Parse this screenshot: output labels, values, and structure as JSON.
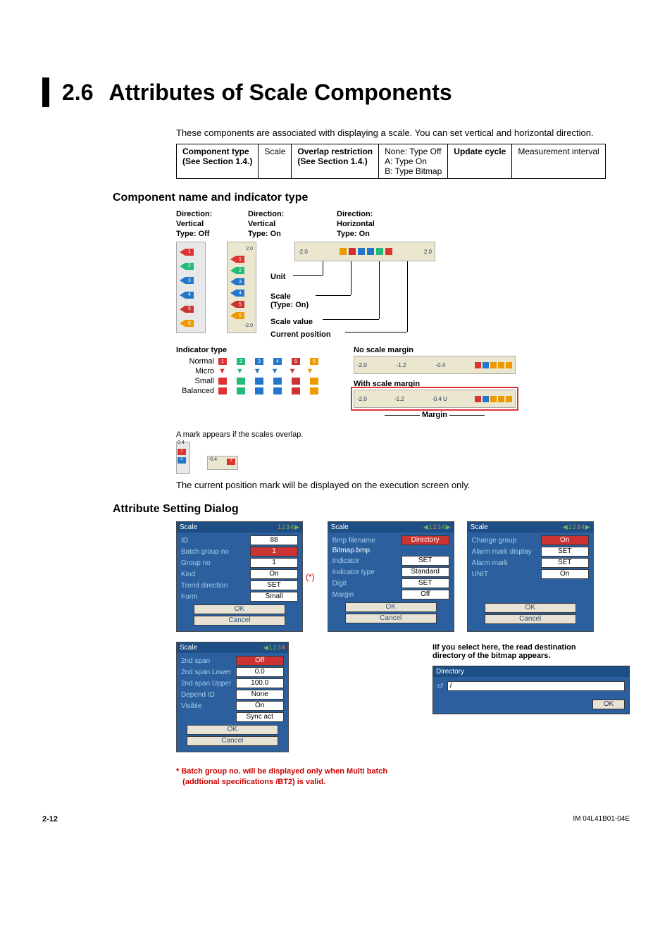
{
  "section_number": "2.6",
  "section_title": "Attributes of Scale Components",
  "intro": "These components are associated with displaying a scale. You can set vertical and horizontal direction.",
  "comp_table": {
    "c1h": "Component type",
    "c1s": "(See Section 1.4.)",
    "c1v": "Scale",
    "c2h": "Overlap restriction",
    "c2s": "(See Section 1.4.)",
    "c2v1": "None: Type Off",
    "c2v2": "A: Type On",
    "c2v3": "B: Type Bitmap",
    "c3h": "Update cycle",
    "c3v": "Measurement interval"
  },
  "h2a": "Component name and indicator type",
  "dirs": {
    "d1a": "Direction:",
    "d1b": "Vertical",
    "d1c": "Type: Off",
    "d2a": "Direction:",
    "d2b": "Vertical",
    "d2c": "Type: On",
    "d3a": "Direction:",
    "d3b": "Horizontal",
    "d3c": "Type: On"
  },
  "callouts": {
    "unit": "Unit",
    "scale1": "Scale",
    "scale2": "(Type: On)",
    "scalevalue": "Scale value",
    "curpos": "Current position"
  },
  "hscale": {
    "left": "-2.0",
    "right": "2.0"
  },
  "indicator": {
    "title": "Indicator type",
    "rows": [
      "Normal",
      "Micro",
      "Small",
      "Balanced"
    ],
    "colors": [
      "#d33",
      "#2b7",
      "#27c",
      "#aa4",
      "#c55",
      "#e90"
    ]
  },
  "margins": {
    "no": "No scale margin",
    "with": "With scale margin",
    "margin": "Margin",
    "a": "-2.0",
    "b": "-1.2",
    "c": "-0.4"
  },
  "overlap_note": "A mark appears if the scales overlap.",
  "ov_v_val": "0.4",
  "ov_h_val": "-0.4",
  "exec_note": "The current position mark will be displayed on the execution screen only.",
  "h2b": "Attribute Setting Dialog",
  "dlg1": {
    "title": "Scale",
    "tabs": "1 2 3 4 ▶",
    "fields": [
      [
        "ID",
        "88"
      ],
      [
        "Batch group no",
        "1"
      ],
      [
        "Group no",
        "1"
      ],
      [
        "Kind",
        "On"
      ],
      [
        "Trend direction",
        "SET"
      ],
      [
        "Form",
        "Small"
      ]
    ],
    "ok": "OK",
    "cancel": "Cancel"
  },
  "dlg2": {
    "title": "Scale",
    "tabs": "◀ 1 2 3 4 ▶",
    "fields": [
      [
        "Bmp filename",
        "Directory"
      ],
      [
        "Bitmap.bmp",
        ""
      ],
      [
        "Indicator",
        "SET"
      ],
      [
        "Indicator type",
        "Standard"
      ],
      [
        "Digit",
        "SET"
      ],
      [
        "Margin",
        "Off"
      ]
    ],
    "ok": "OK",
    "cancel": "Cancel"
  },
  "dlg3": {
    "title": "Scale",
    "tabs": "◀ 1 2 3 4 ▶",
    "fields": [
      [
        "Change group",
        "On"
      ],
      [
        "Alarm mark display",
        "SET"
      ],
      [
        "Alarm mark",
        "SET"
      ],
      [
        "UNIT",
        "On"
      ]
    ],
    "ok": "OK",
    "cancel": "Cancel"
  },
  "dlg4": {
    "title": "Scale",
    "tabs": "◀ 1 2 3 4",
    "fields": [
      [
        "2nd span",
        "Off"
      ],
      [
        "2nd span    Lower",
        "0.0"
      ],
      [
        "2nd span    Upper",
        "100.0"
      ],
      [
        "Depend ID",
        "None"
      ],
      [
        "Visible",
        "On"
      ],
      [
        "",
        "Sync act"
      ]
    ],
    "ok": "OK",
    "cancel": "Cancel"
  },
  "asterisk": "(*)",
  "side_note1": "If you select here, the read destination directory of the bitmap appears.",
  "dir_dlg": {
    "title": "Directory",
    "lab": "cf",
    "val": "/",
    "ok": "OK"
  },
  "foot_note1": "*  Batch group no. will be displayed only when Multi batch",
  "foot_note2": "(addtional specifications /BT2) is valid.",
  "footer": {
    "page": "2-12",
    "doc": "IM 04L41B01-04E"
  }
}
